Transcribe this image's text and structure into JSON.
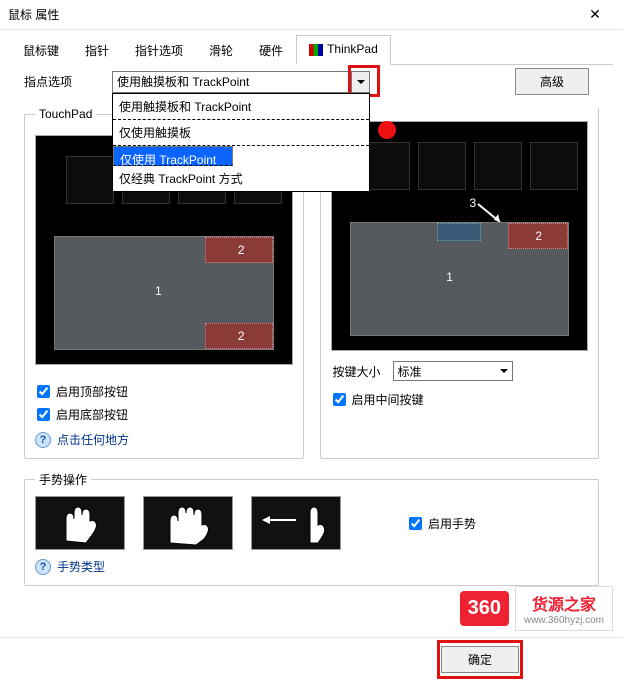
{
  "window": {
    "title": "鼠标 属性"
  },
  "tabs": [
    "鼠标键",
    "指针",
    "指针选项",
    "滑轮",
    "硬件",
    "ThinkPad"
  ],
  "active_tab": "ThinkPad",
  "pointing": {
    "label": "指点选项",
    "value": "使用触摸板和 TrackPoint",
    "options": [
      "使用触摸板和 TrackPoint",
      "仅使用触摸板",
      "仅使用 TrackPoint",
      "仅经典 TrackPoint 方式"
    ],
    "selected_index": 2
  },
  "advanced": "高级",
  "touchpad": {
    "legend": "TouchPad",
    "n1": "1",
    "n2a": "2",
    "n2b": "2",
    "chk_top": "启用顶部按钮",
    "chk_bottom": "启用底部按钮",
    "help": "点击任何地方"
  },
  "trackpoint": {
    "n1": "1",
    "n2": "2",
    "n3": "3",
    "size_label": "按键大小",
    "size_value": "标准",
    "chk_mid": "启用中间按键"
  },
  "gesture": {
    "legend": "手势操作",
    "chk": "启用手势",
    "help": "手势类型"
  },
  "footer": {
    "ok": "确定"
  },
  "watermark": {
    "brand": "360",
    "text": "货源之家",
    "url": "www.360hyzj.com"
  }
}
